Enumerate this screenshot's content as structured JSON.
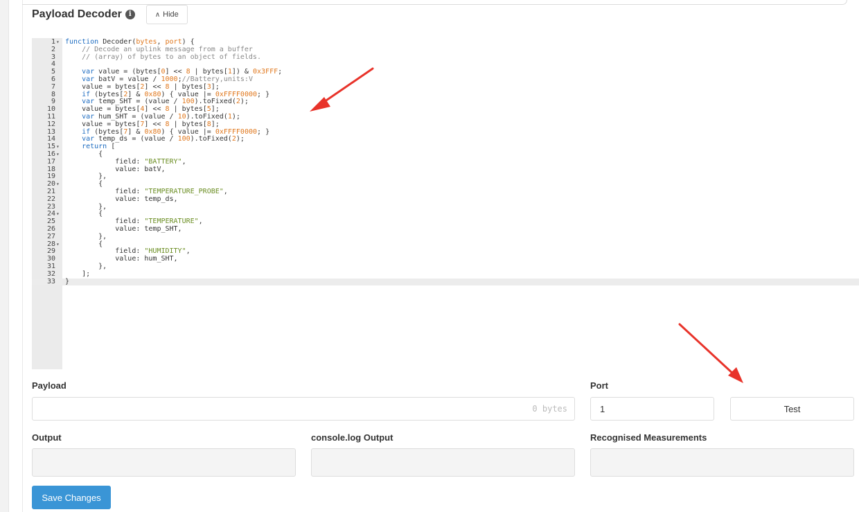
{
  "header": {
    "title": "Payload Decoder",
    "info_icon": "info-icon",
    "hide_label": "Hide",
    "hide_icon": "chevron-up-icon"
  },
  "editor": {
    "active_line": 33,
    "lines": [
      {
        "n": "1",
        "fold": true,
        "t": [
          [
            "k",
            "function "
          ],
          [
            "p",
            "Decoder("
          ],
          [
            "n",
            "bytes"
          ],
          [
            "p",
            ", "
          ],
          [
            "n",
            "port"
          ],
          [
            "p",
            ") {"
          ]
        ]
      },
      {
        "n": "2",
        "t": [
          [
            "c",
            "    // Decode an uplink message from a buffer"
          ]
        ]
      },
      {
        "n": "3",
        "t": [
          [
            "c",
            "    // (array) of bytes to an object of fields."
          ]
        ]
      },
      {
        "n": "4",
        "t": []
      },
      {
        "n": "5",
        "t": [
          [
            "k",
            "    var "
          ],
          [
            "p",
            "value = (bytes["
          ],
          [
            "n",
            "0"
          ],
          [
            "p",
            "] << "
          ],
          [
            "n",
            "8"
          ],
          [
            "p",
            " | bytes["
          ],
          [
            "n",
            "1"
          ],
          [
            "p",
            "]) & "
          ],
          [
            "n",
            "0x3FFF"
          ],
          [
            "p",
            ";"
          ]
        ]
      },
      {
        "n": "6",
        "t": [
          [
            "k",
            "    var "
          ],
          [
            "p",
            "batV = value / "
          ],
          [
            "n",
            "1000"
          ],
          [
            "p",
            ";"
          ],
          [
            "c",
            "//Battery,units:V"
          ]
        ]
      },
      {
        "n": "7",
        "t": [
          [
            "p",
            "    value = bytes["
          ],
          [
            "n",
            "2"
          ],
          [
            "p",
            "] << "
          ],
          [
            "n",
            "8"
          ],
          [
            "p",
            " | bytes["
          ],
          [
            "n",
            "3"
          ],
          [
            "p",
            "];"
          ]
        ]
      },
      {
        "n": "8",
        "t": [
          [
            "k",
            "    if "
          ],
          [
            "p",
            "(bytes["
          ],
          [
            "n",
            "2"
          ],
          [
            "p",
            "] & "
          ],
          [
            "n",
            "0x80"
          ],
          [
            "p",
            ") { value |= "
          ],
          [
            "n",
            "0xFFFF0000"
          ],
          [
            "p",
            "; }"
          ]
        ]
      },
      {
        "n": "9",
        "t": [
          [
            "k",
            "    var "
          ],
          [
            "p",
            "temp_SHT = (value / "
          ],
          [
            "n",
            "100"
          ],
          [
            "p",
            ").toFixed("
          ],
          [
            "n",
            "2"
          ],
          [
            "p",
            ");"
          ]
        ]
      },
      {
        "n": "10",
        "t": [
          [
            "p",
            "    value = bytes["
          ],
          [
            "n",
            "4"
          ],
          [
            "p",
            "] << "
          ],
          [
            "n",
            "8"
          ],
          [
            "p",
            " | bytes["
          ],
          [
            "n",
            "5"
          ],
          [
            "p",
            "];"
          ]
        ]
      },
      {
        "n": "11",
        "t": [
          [
            "k",
            "    var "
          ],
          [
            "p",
            "hum_SHT = (value / "
          ],
          [
            "n",
            "10"
          ],
          [
            "p",
            ").toFixed("
          ],
          [
            "n",
            "1"
          ],
          [
            "p",
            ");"
          ]
        ]
      },
      {
        "n": "12",
        "t": [
          [
            "p",
            "    value = bytes["
          ],
          [
            "n",
            "7"
          ],
          [
            "p",
            "] << "
          ],
          [
            "n",
            "8"
          ],
          [
            "p",
            " | bytes["
          ],
          [
            "n",
            "8"
          ],
          [
            "p",
            "];"
          ]
        ]
      },
      {
        "n": "13",
        "t": [
          [
            "k",
            "    if "
          ],
          [
            "p",
            "(bytes["
          ],
          [
            "n",
            "7"
          ],
          [
            "p",
            "] & "
          ],
          [
            "n",
            "0x80"
          ],
          [
            "p",
            ") { value |= "
          ],
          [
            "n",
            "0xFFFF0000"
          ],
          [
            "p",
            "; }"
          ]
        ]
      },
      {
        "n": "14",
        "t": [
          [
            "k",
            "    var "
          ],
          [
            "p",
            "temp_ds = (value / "
          ],
          [
            "n",
            "100"
          ],
          [
            "p",
            ").toFixed("
          ],
          [
            "n",
            "2"
          ],
          [
            "p",
            ");"
          ]
        ]
      },
      {
        "n": "15",
        "fold": true,
        "t": [
          [
            "k",
            "    return "
          ],
          [
            "p",
            "["
          ]
        ]
      },
      {
        "n": "16",
        "fold": true,
        "t": [
          [
            "p",
            "        {"
          ]
        ]
      },
      {
        "n": "17",
        "t": [
          [
            "p",
            "            field: "
          ],
          [
            "s",
            "\"BATTERY\""
          ],
          [
            "p",
            ","
          ]
        ]
      },
      {
        "n": "18",
        "t": [
          [
            "p",
            "            value: batV,"
          ]
        ]
      },
      {
        "n": "19",
        "t": [
          [
            "p",
            "        },"
          ]
        ]
      },
      {
        "n": "20",
        "fold": true,
        "t": [
          [
            "p",
            "        {"
          ]
        ]
      },
      {
        "n": "21",
        "t": [
          [
            "p",
            "            field: "
          ],
          [
            "s",
            "\"TEMPERATURE_PROBE\""
          ],
          [
            "p",
            ","
          ]
        ]
      },
      {
        "n": "22",
        "t": [
          [
            "p",
            "            value: temp_ds,"
          ]
        ]
      },
      {
        "n": "23",
        "t": [
          [
            "p",
            "        },"
          ]
        ]
      },
      {
        "n": "24",
        "fold": true,
        "t": [
          [
            "p",
            "        {"
          ]
        ]
      },
      {
        "n": "25",
        "t": [
          [
            "p",
            "            field: "
          ],
          [
            "s",
            "\"TEMPERATURE\""
          ],
          [
            "p",
            ","
          ]
        ]
      },
      {
        "n": "26",
        "t": [
          [
            "p",
            "            value: temp_SHT,"
          ]
        ]
      },
      {
        "n": "27",
        "t": [
          [
            "p",
            "        },"
          ]
        ]
      },
      {
        "n": "28",
        "fold": true,
        "t": [
          [
            "p",
            "        {"
          ]
        ]
      },
      {
        "n": "29",
        "t": [
          [
            "p",
            "            field: "
          ],
          [
            "s",
            "\"HUMIDITY\""
          ],
          [
            "p",
            ","
          ]
        ]
      },
      {
        "n": "30",
        "t": [
          [
            "p",
            "            value: hum_SHT,"
          ]
        ]
      },
      {
        "n": "31",
        "t": [
          [
            "p",
            "        },"
          ]
        ]
      },
      {
        "n": "32",
        "t": [
          [
            "p",
            "    ];"
          ]
        ]
      },
      {
        "n": "33",
        "t": [
          [
            "p",
            "}"
          ]
        ]
      }
    ]
  },
  "payload": {
    "label": "Payload",
    "bytes_hint": "0 bytes",
    "value": ""
  },
  "port": {
    "label": "Port",
    "value": "1"
  },
  "test_button": "Test",
  "outputs": {
    "output_label": "Output",
    "console_label": "console.log Output",
    "measurements_label": "Recognised Measurements"
  },
  "save_button": "Save Changes",
  "colors": {
    "accent": "#3a95d6",
    "arrow": "#e8332a",
    "keyword": "#1c6bc0",
    "string": "#6b8e23",
    "number": "#e0771c"
  }
}
